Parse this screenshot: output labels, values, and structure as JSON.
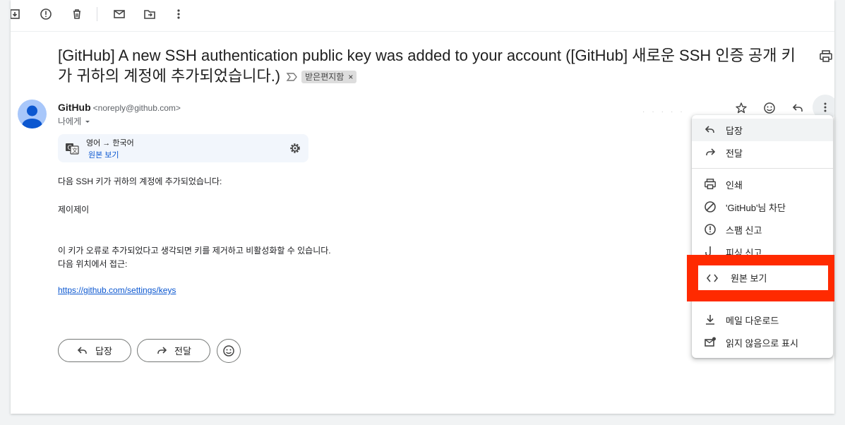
{
  "toolbar": {
    "icons": [
      "archive-icon",
      "report-spam-icon",
      "delete-icon",
      "mark-unread-icon",
      "move-to-icon",
      "more-vert-icon"
    ]
  },
  "subject": {
    "text": "[GitHub] A new SSH authentication public key was added to your account ([GitHub] 새로운 SSH 인증 공개 키가 귀하의 계정에 추가되었습니다.)",
    "label": "받은편지함",
    "label_remove": "×"
  },
  "sender": {
    "name": "GitHub",
    "email": "<noreply@github.com>",
    "to": "나에게"
  },
  "translate": {
    "langs": "영어 → 한국어",
    "original_link": "원본 보기"
  },
  "body": {
    "line1": "다음 SSH 키가 귀하의 계정에 추가되었습니다:",
    "line2": "제이제이",
    "line3": "이 키가 오류로 추가되었다고 생각되면 키를 제거하고 비활성화할 수 있습니다.",
    "line4": "다음 위치에서 접근:",
    "link": "https://github.com/settings/keys"
  },
  "actions": {
    "reply": "답장",
    "forward": "전달"
  },
  "menu": {
    "reply": "답장",
    "forward": "전달",
    "print": "인쇄",
    "block": "'GitHub'님 차단",
    "report_spam": "스팸 신고",
    "report_phishing": "피싱 신고",
    "show_original": "원본 보기",
    "download": "메일 다운로드",
    "mark_unread": "읽지 않음으로 표시"
  },
  "colors": {
    "highlight": "#ff2a00",
    "link": "#0b57d0",
    "avatar": "#a8c7fa"
  }
}
